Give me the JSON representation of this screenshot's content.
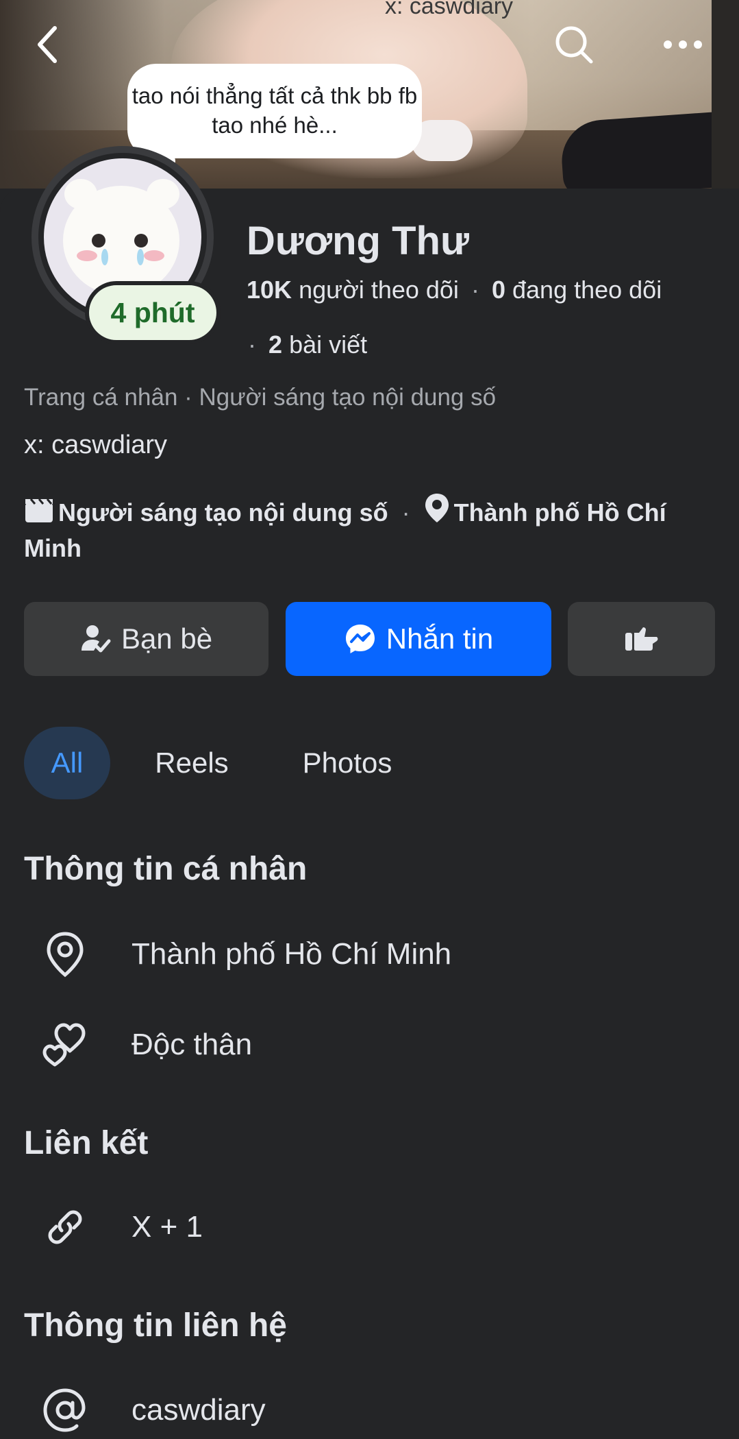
{
  "cover": {
    "watermark_text": "x: caswdiary"
  },
  "nav": {
    "back_icon": "back-arrow-icon",
    "search_icon": "search-icon",
    "more_icon": "more-icon"
  },
  "note": {
    "text": "tao nói thẳng tất cả thk bb fb tao nhé hè..."
  },
  "profile": {
    "status": "4 phút",
    "name": "Dương Thư",
    "followers_count": "10K",
    "followers_label": "người theo dõi",
    "following_count": "0",
    "following_label": "đang theo dõi",
    "posts_count": "2",
    "posts_label": "bài viết",
    "category_line": "Trang cá nhân · Người sáng tạo nội dung số",
    "bio": "x: caswdiary",
    "creator_label": "Người sáng tạo nội dung số",
    "location_label": "Thành phố Hồ Chí Minh"
  },
  "actions": {
    "friends_label": "Bạn bè",
    "message_label": "Nhắn tin",
    "poke_icon": "poke-hand-icon"
  },
  "tabs": [
    {
      "label": "All",
      "active": true
    },
    {
      "label": "Reels",
      "active": false
    },
    {
      "label": "Photos",
      "active": false
    }
  ],
  "sections": {
    "personal_title": "Thông tin cá nhân",
    "personal_items": [
      {
        "icon": "location-pin-icon",
        "text": "Thành phố Hồ Chí Minh"
      },
      {
        "icon": "hearts-icon",
        "text": "Độc thân"
      }
    ],
    "links_title": "Liên kết",
    "links_items": [
      {
        "icon": "link-icon",
        "text": "X + 1"
      }
    ],
    "contact_title": "Thông tin liên hệ",
    "contact_items": [
      {
        "icon": "at-sign-icon",
        "text": "caswdiary"
      }
    ]
  },
  "colors": {
    "background": "#242527",
    "accent": "#0866ff",
    "tab_active_bg": "#263951",
    "tab_active_text": "#4599ff",
    "status_green": "#1f6b2a"
  }
}
